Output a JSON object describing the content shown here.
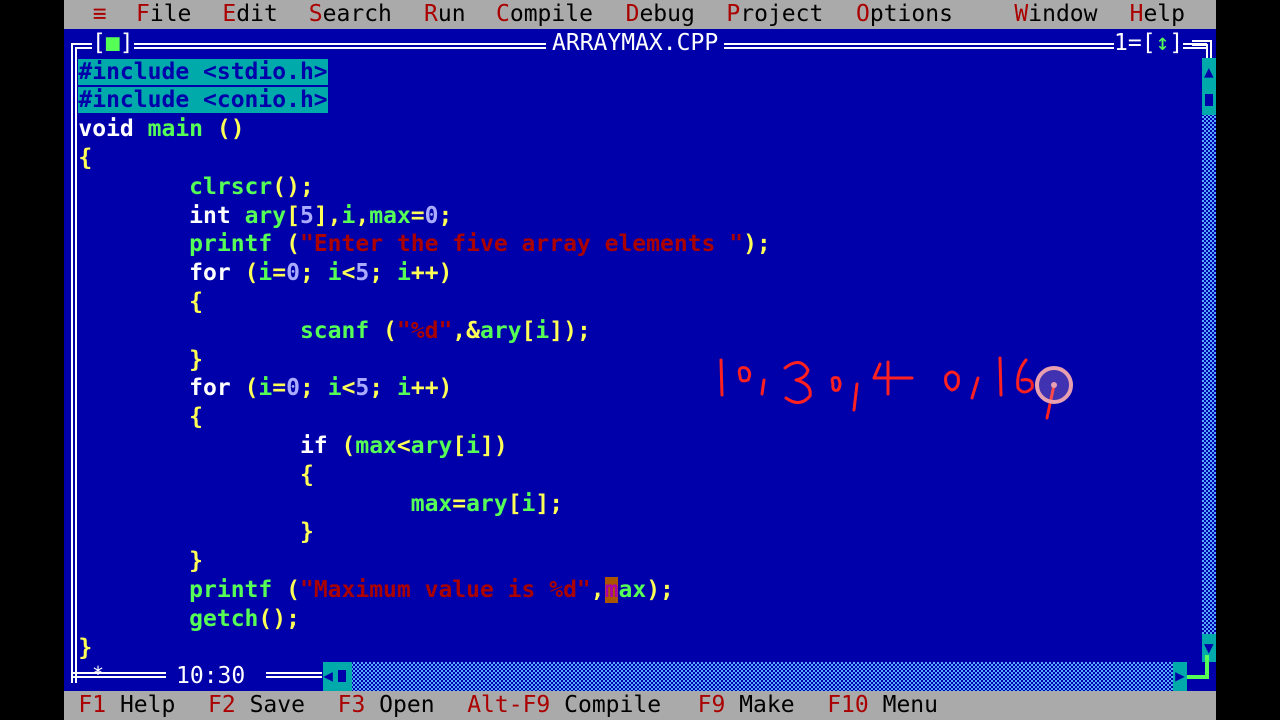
{
  "menubar": {
    "system_icon": "≡",
    "items": [
      {
        "hot": "F",
        "rest": "ile"
      },
      {
        "hot": "E",
        "rest": "dit"
      },
      {
        "hot": "S",
        "rest": "earch"
      },
      {
        "hot": "R",
        "rest": "un"
      },
      {
        "hot": "C",
        "rest": "ompile"
      },
      {
        "hot": "D",
        "rest": "ebug"
      },
      {
        "hot": "P",
        "rest": "roject"
      },
      {
        "hot": "O",
        "rest": "ptions"
      },
      {
        "hot": "W",
        "rest": "indow"
      },
      {
        "hot": "H",
        "rest": "elp"
      }
    ]
  },
  "window": {
    "title": "ARRAYMAX.CPP",
    "number": "1",
    "close_box": "■",
    "zoom_arrow": "↕",
    "position": "10:30",
    "modified_marker": "*"
  },
  "editor": {
    "lines": [
      [
        {
          "c": "sel",
          "t": "#include <stdio.h>"
        }
      ],
      [
        {
          "c": "sel",
          "t": "#include <conio.h>"
        }
      ],
      [
        {
          "c": "kw",
          "t": "void "
        },
        {
          "c": "id",
          "t": "main "
        },
        {
          "c": "pu",
          "t": "()"
        }
      ],
      [
        {
          "c": "pu",
          "t": "{"
        }
      ],
      [
        {
          "c": "",
          "t": "        "
        },
        {
          "c": "fn",
          "t": "clrscr"
        },
        {
          "c": "pu",
          "t": "();"
        }
      ],
      [
        {
          "c": "",
          "t": "        "
        },
        {
          "c": "kw",
          "t": "int "
        },
        {
          "c": "id",
          "t": "ary"
        },
        {
          "c": "pu",
          "t": "["
        },
        {
          "c": "nu",
          "t": "5"
        },
        {
          "c": "pu",
          "t": "],"
        },
        {
          "c": "id",
          "t": "i"
        },
        {
          "c": "pu",
          "t": ","
        },
        {
          "c": "id",
          "t": "max"
        },
        {
          "c": "pu",
          "t": "="
        },
        {
          "c": "nu",
          "t": "0"
        },
        {
          "c": "pu",
          "t": ";"
        }
      ],
      [
        {
          "c": "",
          "t": "        "
        },
        {
          "c": "fn",
          "t": "printf "
        },
        {
          "c": "pu",
          "t": "("
        },
        {
          "c": "st",
          "t": "\"Enter the five array elements \""
        },
        {
          "c": "pu",
          "t": ");"
        }
      ],
      [
        {
          "c": "",
          "t": "        "
        },
        {
          "c": "kw",
          "t": "for "
        },
        {
          "c": "pu",
          "t": "("
        },
        {
          "c": "id",
          "t": "i"
        },
        {
          "c": "pu",
          "t": "="
        },
        {
          "c": "nu",
          "t": "0"
        },
        {
          "c": "pu",
          "t": "; "
        },
        {
          "c": "id",
          "t": "i"
        },
        {
          "c": "pu",
          "t": "<"
        },
        {
          "c": "nu",
          "t": "5"
        },
        {
          "c": "pu",
          "t": "; "
        },
        {
          "c": "id",
          "t": "i"
        },
        {
          "c": "pu",
          "t": "++)"
        }
      ],
      [
        {
          "c": "",
          "t": "        "
        },
        {
          "c": "pu",
          "t": "{"
        }
      ],
      [
        {
          "c": "",
          "t": "                "
        },
        {
          "c": "fn",
          "t": "scanf "
        },
        {
          "c": "pu",
          "t": "("
        },
        {
          "c": "st",
          "t": "\"%d\""
        },
        {
          "c": "pu",
          "t": ",&"
        },
        {
          "c": "id",
          "t": "ary"
        },
        {
          "c": "pu",
          "t": "["
        },
        {
          "c": "id",
          "t": "i"
        },
        {
          "c": "pu",
          "t": "]);"
        }
      ],
      [
        {
          "c": "",
          "t": "        "
        },
        {
          "c": "pu",
          "t": "}"
        }
      ],
      [
        {
          "c": "",
          "t": "        "
        },
        {
          "c": "kw",
          "t": "for "
        },
        {
          "c": "pu",
          "t": "("
        },
        {
          "c": "id",
          "t": "i"
        },
        {
          "c": "pu",
          "t": "="
        },
        {
          "c": "nu",
          "t": "0"
        },
        {
          "c": "pu",
          "t": "; "
        },
        {
          "c": "id",
          "t": "i"
        },
        {
          "c": "pu",
          "t": "<"
        },
        {
          "c": "nu",
          "t": "5"
        },
        {
          "c": "pu",
          "t": "; "
        },
        {
          "c": "id",
          "t": "i"
        },
        {
          "c": "pu",
          "t": "++)"
        }
      ],
      [
        {
          "c": "",
          "t": "        "
        },
        {
          "c": "pu",
          "t": "{"
        }
      ],
      [
        {
          "c": "",
          "t": "                "
        },
        {
          "c": "kw",
          "t": "if "
        },
        {
          "c": "pu",
          "t": "("
        },
        {
          "c": "id",
          "t": "max"
        },
        {
          "c": "pu",
          "t": "<"
        },
        {
          "c": "id",
          "t": "ary"
        },
        {
          "c": "pu",
          "t": "["
        },
        {
          "c": "id",
          "t": "i"
        },
        {
          "c": "pu",
          "t": "])"
        }
      ],
      [
        {
          "c": "",
          "t": "                "
        },
        {
          "c": "pu",
          "t": "{"
        }
      ],
      [
        {
          "c": "",
          "t": "                        "
        },
        {
          "c": "id",
          "t": "max"
        },
        {
          "c": "pu",
          "t": "="
        },
        {
          "c": "id",
          "t": "ary"
        },
        {
          "c": "pu",
          "t": "["
        },
        {
          "c": "id",
          "t": "i"
        },
        {
          "c": "pu",
          "t": "];"
        }
      ],
      [
        {
          "c": "",
          "t": "                "
        },
        {
          "c": "pu",
          "t": "}"
        }
      ],
      [
        {
          "c": "",
          "t": "        "
        },
        {
          "c": "pu",
          "t": "}"
        }
      ],
      [
        {
          "c": "",
          "t": "        "
        },
        {
          "c": "fn",
          "t": "printf "
        },
        {
          "c": "pu",
          "t": "("
        },
        {
          "c": "st",
          "t": "\"Maximum value is %d\""
        },
        {
          "c": "pu",
          "t": ","
        },
        {
          "c": "cursor",
          "t": "m"
        },
        {
          "c": "id",
          "t": "ax"
        },
        {
          "c": "pu",
          "t": ");"
        }
      ],
      [
        {
          "c": "",
          "t": "        "
        },
        {
          "c": "fn",
          "t": "getch"
        },
        {
          "c": "pu",
          "t": "();"
        }
      ],
      [
        {
          "c": "pu",
          "t": "}"
        }
      ]
    ]
  },
  "annotation": {
    "handwritten_text": "10,30,40,160",
    "ink_color": "#ff2020"
  },
  "statusbar": {
    "items": [
      {
        "key": "F1",
        "label": "Help"
      },
      {
        "key": "F2",
        "label": "Save"
      },
      {
        "key": "F3",
        "label": "Open"
      },
      {
        "key": "Alt-F9",
        "label": "Compile"
      },
      {
        "key": "F9",
        "label": "Make"
      },
      {
        "key": "F10",
        "label": "Menu"
      }
    ]
  },
  "colors": {
    "editor_bg": "#0000aa",
    "menu_bg": "#aaaaaa",
    "hotkey": "#aa0000",
    "selection_bg": "#00aaaa"
  }
}
